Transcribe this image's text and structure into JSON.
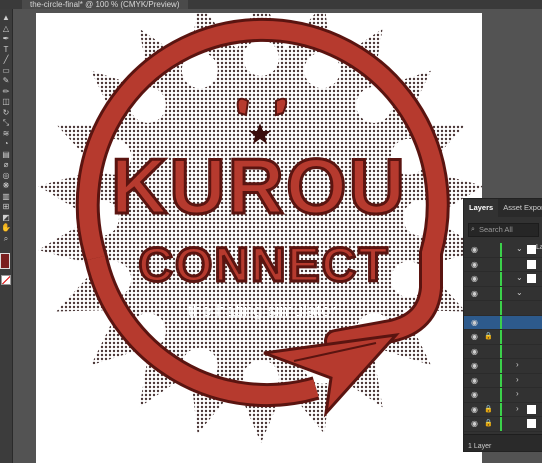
{
  "document_tab": {
    "title": "the-circle-final* @ 100 % (CMYK/Preview)"
  },
  "toolbar": {
    "tools": [
      {
        "name": "selection-tool-icon",
        "glyph": "▲"
      },
      {
        "name": "direct-selection-icon",
        "glyph": "△"
      },
      {
        "name": "pen-tool-icon",
        "glyph": "✒"
      },
      {
        "name": "type-tool-icon",
        "glyph": "T"
      },
      {
        "name": "line-tool-icon",
        "glyph": "╱"
      },
      {
        "name": "rectangle-tool-icon",
        "glyph": "▭"
      },
      {
        "name": "paintbrush-icon",
        "glyph": "✎"
      },
      {
        "name": "pencil-icon",
        "glyph": "✏"
      },
      {
        "name": "eraser-icon",
        "glyph": "◫"
      },
      {
        "name": "rotate-tool-icon",
        "glyph": "↻"
      },
      {
        "name": "scale-tool-icon",
        "glyph": "⤡"
      },
      {
        "name": "width-tool-icon",
        "glyph": "≋"
      },
      {
        "name": "shape-builder-icon",
        "glyph": "◔"
      },
      {
        "name": "gradient-icon",
        "glyph": "▤"
      },
      {
        "name": "eyedropper-icon",
        "glyph": "⌀"
      },
      {
        "name": "blend-tool-icon",
        "glyph": "◎"
      },
      {
        "name": "symbol-sprayer-icon",
        "glyph": "❋"
      },
      {
        "name": "graph-tool-icon",
        "glyph": "▥"
      },
      {
        "name": "artboard-tool-icon",
        "glyph": "⊞"
      },
      {
        "name": "slice-tool-icon",
        "glyph": "◩"
      },
      {
        "name": "hand-tool-icon",
        "glyph": "✋"
      },
      {
        "name": "zoom-tool-icon",
        "glyph": "⌕"
      }
    ],
    "fill_color": "#7a1f1f"
  },
  "artwork": {
    "title_line1": "KUROU",
    "title_line2": "CONNECT",
    "tagline": "the hating simulator",
    "colors": {
      "red": "#b63a2e",
      "dark": "#5a1410",
      "halftone": "#2a1212"
    }
  },
  "layers_panel": {
    "tabs": [
      {
        "label": "Layers",
        "active": true
      },
      {
        "label": "Asset Export",
        "active": false
      }
    ],
    "search_placeholder": "Search All",
    "layer_name": "Layer",
    "footer": "1 Layer",
    "rows": [
      {
        "eye": true,
        "lock": false,
        "chevron": "⌄",
        "thumb": true,
        "selected": false,
        "name": "Layer"
      },
      {
        "eye": true,
        "lock": false,
        "chevron": "",
        "thumb": true,
        "selected": false,
        "name": ""
      },
      {
        "eye": true,
        "lock": false,
        "chevron": "⌄",
        "thumb": true,
        "selected": false,
        "name": ""
      },
      {
        "eye": true,
        "lock": false,
        "chevron": "⌄",
        "thumb": false,
        "selected": false,
        "name": ""
      },
      {
        "eye": false,
        "lock": false,
        "chevron": "",
        "thumb": false,
        "selected": false,
        "name": ""
      },
      {
        "eye": true,
        "lock": false,
        "chevron": "",
        "thumb": false,
        "selected": true,
        "name": ""
      },
      {
        "eye": true,
        "lock": true,
        "chevron": "",
        "thumb": false,
        "selected": false,
        "name": ""
      },
      {
        "eye": true,
        "lock": false,
        "chevron": "",
        "thumb": false,
        "selected": false,
        "name": ""
      },
      {
        "eye": true,
        "lock": false,
        "chevron": "›",
        "thumb": false,
        "selected": false,
        "name": ""
      },
      {
        "eye": true,
        "lock": false,
        "chevron": "›",
        "thumb": false,
        "selected": false,
        "name": ""
      },
      {
        "eye": true,
        "lock": false,
        "chevron": "›",
        "thumb": false,
        "selected": false,
        "name": ""
      },
      {
        "eye": true,
        "lock": true,
        "chevron": "›",
        "thumb": true,
        "selected": false,
        "name": ""
      },
      {
        "eye": true,
        "lock": true,
        "chevron": "",
        "thumb": true,
        "selected": false,
        "name": ""
      }
    ]
  }
}
